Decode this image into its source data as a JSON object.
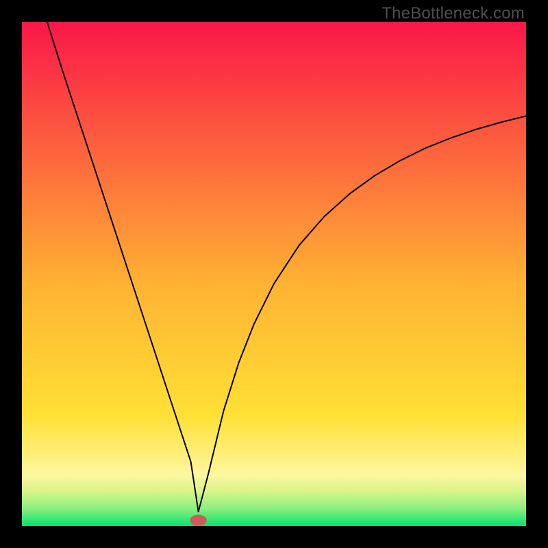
{
  "attribution": "TheBottleneck.com",
  "colors": {
    "top": "#fa1748",
    "mid": "#ffe035",
    "bottom": "#04e271",
    "curve": "#000000",
    "marker_fill": "#cc5e5a",
    "marker_stroke": "#cc5e5a",
    "frame": "#000000"
  },
  "chart_data": {
    "type": "line",
    "title": "",
    "xlabel": "",
    "ylabel": "",
    "xlim": [
      0,
      100
    ],
    "ylim": [
      0,
      105
    ],
    "curve": {
      "x": [
        5,
        8,
        11,
        14,
        17,
        20,
        23,
        26,
        29,
        31.5,
        33.5,
        35,
        37,
        40,
        43,
        46,
        50,
        55,
        60,
        65,
        70,
        75,
        80,
        85,
        90,
        95,
        100
      ],
      "y": [
        105,
        95,
        85.4,
        75.8,
        66.2,
        56.6,
        47.0,
        37.4,
        27.8,
        19.8,
        13.4,
        3,
        11,
        24,
        34,
        42,
        50.5,
        58.5,
        64.5,
        69.2,
        73.0,
        76.1,
        78.7,
        80.8,
        82.6,
        84.1,
        85.4
      ]
    },
    "marker": {
      "x": 35.0,
      "y": 1.2,
      "rx": 1.6,
      "ry": 1.1
    }
  }
}
